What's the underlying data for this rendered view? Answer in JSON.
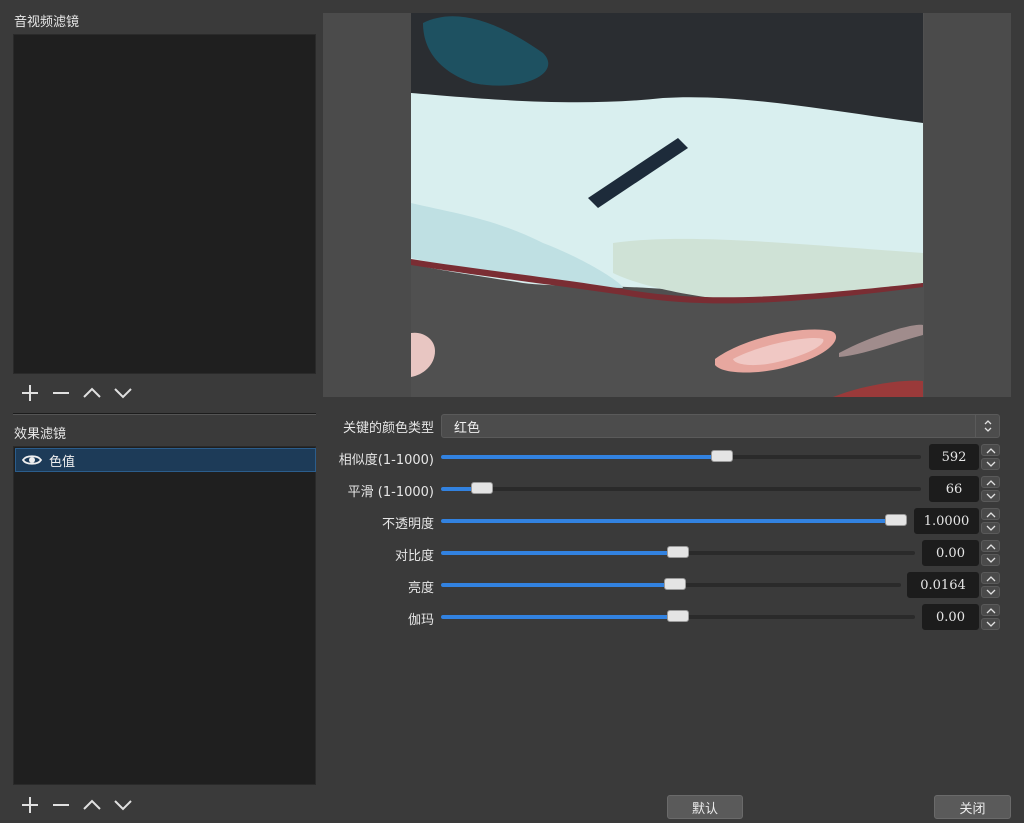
{
  "window": {
    "audio_video_filters_label": "音视频滤镜",
    "effect_filters_label": "效果滤镜"
  },
  "effect_filters": {
    "items": [
      {
        "label": "色值",
        "visible": true
      }
    ]
  },
  "properties": {
    "key_color_type": {
      "label": "关键的颜色类型",
      "value": "红色"
    },
    "similarity": {
      "label": "相似度(1-1000)",
      "value": "592",
      "fraction": 0.59
    },
    "smoothness": {
      "label": "平滑 (1-1000)",
      "value": "66",
      "fraction": 0.066
    },
    "opacity": {
      "label": "不透明度",
      "value": "1.0000",
      "fraction": 1.0
    },
    "contrast": {
      "label": "对比度",
      "value": "0.00",
      "fraction": 0.5
    },
    "brightness": {
      "label": "亮度",
      "value": "0.0164",
      "fraction": 0.508
    },
    "gamma": {
      "label": "伽玛",
      "value": "0.00",
      "fraction": 0.5
    }
  },
  "buttons": {
    "defaults_label": "默认",
    "close_label": "关闭"
  },
  "colors": {
    "accent": "#3282e0",
    "selection": "#1d3b58"
  }
}
